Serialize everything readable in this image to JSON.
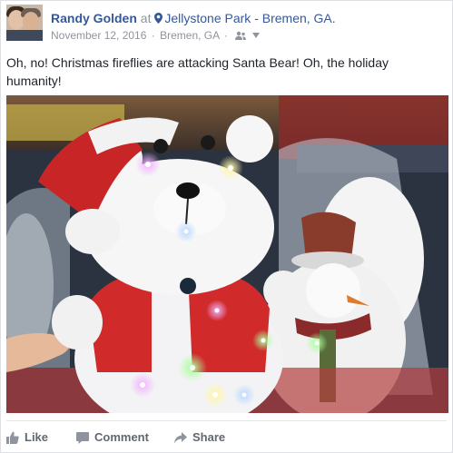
{
  "post": {
    "author": "Randy Golden",
    "at_text": "at",
    "location": "Jellystone Park - Bremen, GA.",
    "date": "November 12, 2016",
    "separator": "·",
    "place": "Bremen, GA",
    "audience_icon": "friends-icon",
    "text": "Oh, no! Christmas fireflies are attacking Santa Bear! Oh, the holiday humanity!"
  },
  "actions": {
    "like": "Like",
    "comment": "Comment",
    "share": "Share"
  },
  "colors": {
    "link": "#365899",
    "meta": "#90949c",
    "text": "#1d2129",
    "action": "#616770"
  }
}
